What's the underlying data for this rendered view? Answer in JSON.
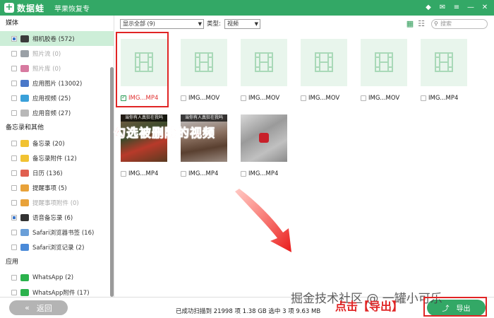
{
  "app": {
    "logo_text": "数据蛙",
    "subtitle": "苹果恢复专"
  },
  "sidebar": {
    "sections": [
      {
        "title": "媒体",
        "items": [
          {
            "label": "相机胶卷 (572)",
            "state": "partial",
            "color": "#3b3b3b",
            "active": true,
            "dim": false
          },
          {
            "label": "照片流 (0)",
            "state": "none",
            "color": "#9aa0a6",
            "active": false,
            "dim": true
          },
          {
            "label": "照片库 (0)",
            "state": "none",
            "color": "#d77aa0",
            "active": false,
            "dim": true
          },
          {
            "label": "应用图片 (13002)",
            "state": "none",
            "color": "#4a78c9",
            "active": false,
            "dim": false
          },
          {
            "label": "应用视频 (25)",
            "state": "none",
            "color": "#3aa0d9",
            "active": false,
            "dim": false
          },
          {
            "label": "应用音频 (27)",
            "state": "none",
            "color": "#b8b8b8",
            "active": false,
            "dim": false
          }
        ]
      },
      {
        "title": "备忘录和其他",
        "items": [
          {
            "label": "备忘录 (20)",
            "state": "none",
            "color": "#f1c232",
            "active": false,
            "dim": false
          },
          {
            "label": "备忘录附件 (12)",
            "state": "none",
            "color": "#f1c232",
            "active": false,
            "dim": false
          },
          {
            "label": "日历 (136)",
            "state": "none",
            "color": "#e06050",
            "active": false,
            "dim": false
          },
          {
            "label": "提醒事项 (5)",
            "state": "none",
            "color": "#e8a23a",
            "active": false,
            "dim": false
          },
          {
            "label": "提醒事项附件 (0)",
            "state": "none",
            "color": "#e8a23a",
            "active": false,
            "dim": true
          },
          {
            "label": "语音备忘录 (6)",
            "state": "partial",
            "color": "#333333",
            "active": false,
            "dim": false
          },
          {
            "label": "Safari浏览器书签 (16)",
            "state": "none",
            "color": "#6a9fd8",
            "active": false,
            "dim": false
          },
          {
            "label": "Safari浏览记录 (2)",
            "state": "none",
            "color": "#4a8ad8",
            "active": false,
            "dim": false
          }
        ]
      },
      {
        "title": "应用",
        "items": [
          {
            "label": "WhatsApp (2)",
            "state": "none",
            "color": "#2bb24c",
            "active": false,
            "dim": false
          },
          {
            "label": "WhatsApp附件 (17)",
            "state": "none",
            "color": "#2bb24c",
            "active": false,
            "dim": false
          }
        ]
      }
    ]
  },
  "toolbar": {
    "filter_value": "显示全部 (9)",
    "type_label": "类型:",
    "type_value": "视频",
    "search_placeholder": "搜索"
  },
  "files": [
    {
      "name": "IMG...MP4",
      "kind": "video",
      "checked": true
    },
    {
      "name": "IMG...MOV",
      "kind": "video",
      "checked": false
    },
    {
      "name": "IMG...MOV",
      "kind": "video",
      "checked": false
    },
    {
      "name": "IMG...MOV",
      "kind": "video",
      "checked": false
    },
    {
      "name": "IMG...MOV",
      "kind": "video",
      "checked": false
    },
    {
      "name": "IMG...MP4",
      "kind": "video",
      "checked": false
    },
    {
      "name": "IMG...MP4",
      "kind": "photo",
      "checked": false,
      "overlay_text": "当你有人真狂在我吗"
    },
    {
      "name": "IMG...MP4",
      "kind": "photo",
      "checked": false,
      "overlay_text": "当你有人真狂在我吗"
    },
    {
      "name": "IMG...MP4",
      "kind": "photo",
      "checked": false
    }
  ],
  "annotations": {
    "select_tip": "勾选被删除的视频",
    "click_tip": "点击【导出】",
    "watermark": "掘金技术社区 @ 一罐小可乐"
  },
  "statusbar": {
    "back_label": "返回",
    "status_text": "已成功扫描到 21998 项 1.38 GB  选中 3 项 9.63 MB",
    "export_label": "导出"
  },
  "colors": {
    "brand": "#33a866",
    "annotation": "#e02525",
    "selected_row": "#cdeed8"
  },
  "icons": [
    "logo-plus-icon",
    "diamond-icon",
    "chat-icon",
    "menu-icon",
    "minimize-icon",
    "close-icon",
    "grid-view-icon",
    "list-view-icon",
    "search-icon",
    "film-icon",
    "back-chevrons-icon",
    "export-icon"
  ]
}
